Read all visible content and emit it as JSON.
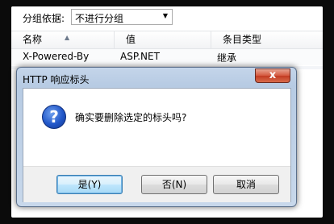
{
  "background_list": {
    "group_by_label": "分组依据:",
    "group_by_value": "不进行分组",
    "columns": [
      "名称",
      "值",
      "条目类型"
    ],
    "rows": [
      {
        "name": "X-Powered-By",
        "value": "ASP.NET",
        "type": "继承"
      }
    ]
  },
  "dialog": {
    "title": "HTTP 响应标头",
    "close_glyph": "x",
    "icon": "question-icon",
    "icon_glyph": "?",
    "message": "确实要删除选定的标头吗?",
    "buttons": {
      "yes": "是(Y)",
      "no": "否(N)",
      "cancel": "取消"
    }
  },
  "colors": {
    "close_button": "#c23b22",
    "default_button_border": "#3c7fb1",
    "question_icon": "#2157c9"
  }
}
